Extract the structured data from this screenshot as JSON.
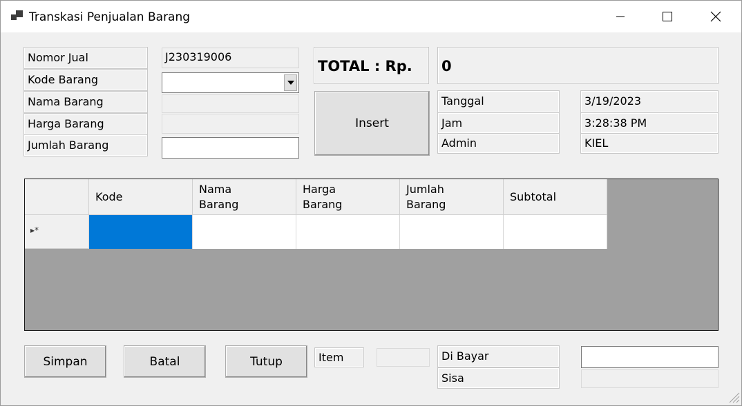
{
  "window": {
    "title": "Transkasi Penjualan Barang"
  },
  "form": {
    "nomor_jual_label": "Nomor Jual",
    "nomor_jual_value": "J230319006",
    "kode_barang_label": "Kode Barang",
    "kode_barang_value": "",
    "nama_barang_label": "Nama Barang",
    "nama_barang_value": "",
    "harga_barang_label": "Harga Barang",
    "harga_barang_value": "",
    "jumlah_barang_label": "Jumlah Barang",
    "jumlah_barang_value": ""
  },
  "total": {
    "label": "TOTAL : Rp.",
    "value": "0"
  },
  "insert_label": "Insert",
  "info": {
    "tanggal_label": "Tanggal",
    "tanggal_value": "3/19/2023",
    "jam_label": "Jam",
    "jam_value": "3:28:38 PM",
    "admin_label": "Admin",
    "admin_value": "KIEL"
  },
  "grid": {
    "columns": [
      "Kode",
      "Nama\nBarang",
      "Harga\nBarang",
      "Jumlah\nBarang",
      "Subtotal"
    ],
    "new_row_marker": "▸*"
  },
  "footer": {
    "simpan_label": "Simpan",
    "batal_label": "Batal",
    "tutup_label": "Tutup",
    "item_label": "Item",
    "item_value": "",
    "dibayar_label": "Di Bayar",
    "dibayar_value": "",
    "sisa_label": "Sisa",
    "sisa_value": ""
  },
  "colors": {
    "selected_cell": "#0078d7",
    "grid_bg": "#a0a0a0"
  }
}
